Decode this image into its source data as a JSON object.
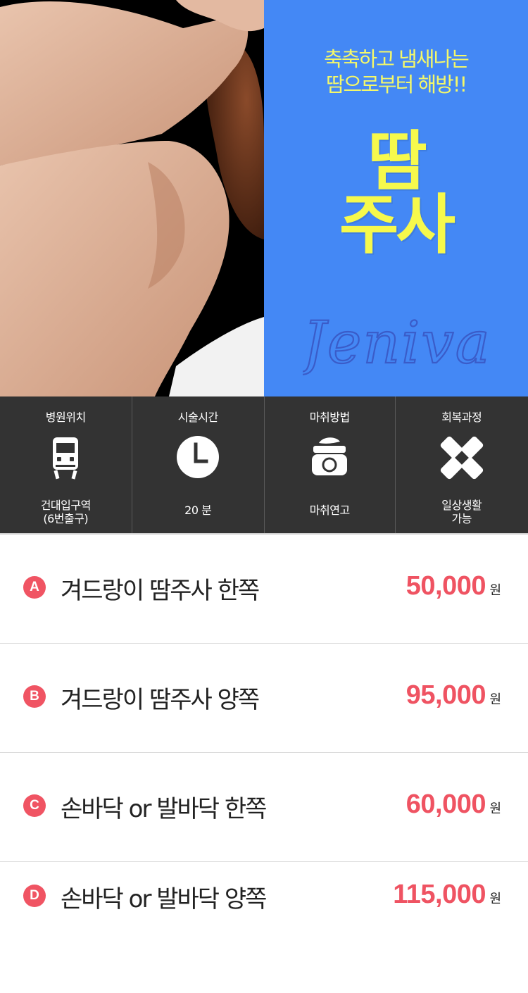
{
  "hero": {
    "tagline_1": "축축하고 냄새나는",
    "tagline_2": "땀으로부터 해방!!",
    "title_1": "땀",
    "title_2": "주사",
    "script_logo": "Jeniva"
  },
  "info": [
    {
      "title": "병원위치",
      "icon": "train-icon",
      "value_1": "건대입구역",
      "value_2": "(6번출구)"
    },
    {
      "title": "시술시간",
      "icon": "clock-icon",
      "value_1": "20 분",
      "value_2": ""
    },
    {
      "title": "마취방법",
      "icon": "ointment-jar-icon",
      "value_1": "마취연고",
      "value_2": ""
    },
    {
      "title": "회복과정",
      "icon": "bandage-icon",
      "value_1": "일상생활",
      "value_2": "가능"
    }
  ],
  "prices": [
    {
      "badge": "A",
      "label": "겨드랑이 땀주사 한쪽",
      "amount": "50,000",
      "unit": "원"
    },
    {
      "badge": "B",
      "label": "겨드랑이 땀주사 양쪽",
      "amount": "95,000",
      "unit": "원"
    },
    {
      "badge": "C",
      "label": "손바닥 or 발바닥 한쪽",
      "amount": "60,000",
      "unit": "원"
    },
    {
      "badge": "D",
      "label": "손바닥 or 발바닥 양쪽",
      "amount": "115,000",
      "unit": "원"
    }
  ],
  "colors": {
    "promo_bg": "#4488f5",
    "title_yellow": "#f6f94c",
    "info_bg": "#333333",
    "accent_red": "#ef5362"
  }
}
